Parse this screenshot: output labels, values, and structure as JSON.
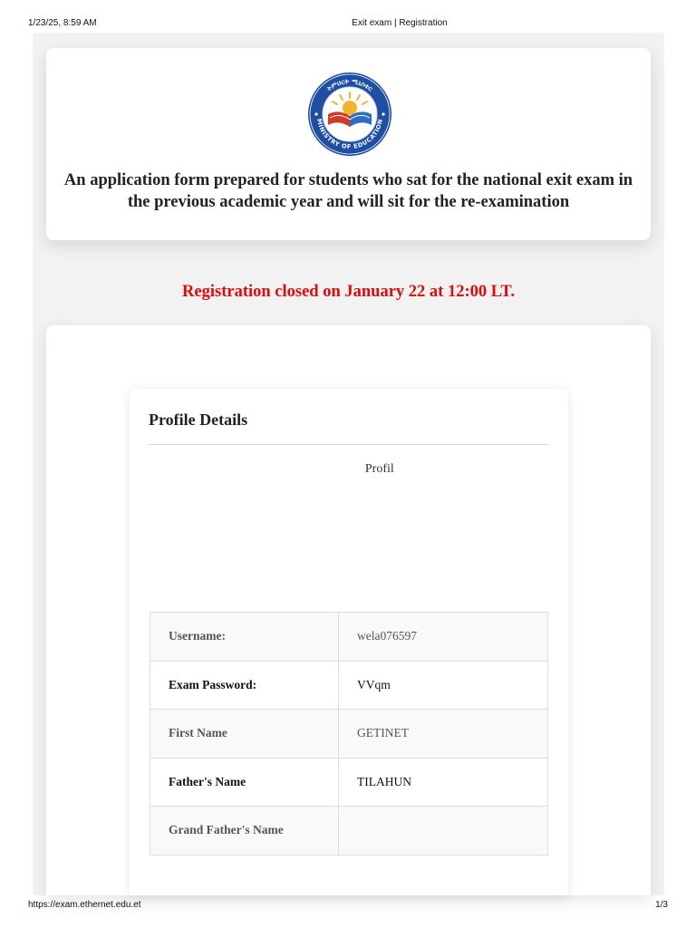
{
  "print_header": {
    "timestamp": "1/23/25, 8:59 AM",
    "title": "Exit exam | Registration"
  },
  "print_footer": {
    "url": "https://exam.ethernet.edu.et",
    "page": "1/3"
  },
  "header": {
    "logo": {
      "icon": "ministry-of-education-seal",
      "ring_text": "MINISTRY OF EDUCATION",
      "top_text": "ትምህርት ሚኒስቴር",
      "colors": {
        "ring": "#1f4fa3",
        "book_left": "#d23a2a",
        "book_right": "#2f6dc4",
        "sun": "#f2b52a"
      }
    },
    "intro": "An application form prepared for students who sat for the national exit exam in the previous academic year and will sit for the re-examination"
  },
  "notice": {
    "text": "Registration closed on January 22 at 12:00 LT.",
    "color": "#e00a0a"
  },
  "profile": {
    "title": "Profile Details",
    "image_alt": "Profile",
    "rows": [
      {
        "label": "Username:",
        "value": "wela076597"
      },
      {
        "label": "Exam Password:",
        "value": "VVqm"
      },
      {
        "label": "First Name",
        "value": "GETINET"
      },
      {
        "label": "Father's Name",
        "value": "TILAHUN"
      },
      {
        "label": "Grand Father's Name",
        "value": ""
      }
    ]
  }
}
